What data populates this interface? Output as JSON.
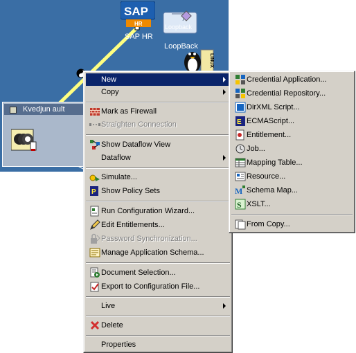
{
  "canvas": {
    "nodes": {
      "sap": {
        "logo_text": "SAP",
        "badge": "HR",
        "label": "SAP HR"
      },
      "loopback": {
        "logo_text": "Loopback",
        "label": "LoopBack"
      },
      "linux": {
        "logo_text": "LINUX"
      }
    },
    "vault": {
      "title": "Kvedjun ault"
    },
    "colors": {
      "background": "#3a6ea5",
      "link": "#ffff80"
    }
  },
  "context_menu": {
    "items": {
      "new": {
        "label": "New",
        "icon": "none",
        "highlighted": true,
        "submenu": true
      },
      "copy": {
        "label": "Copy",
        "submenu": true
      },
      "mark_firewall": {
        "label": "Mark as Firewall",
        "icon": "firewall-icon"
      },
      "straighten": {
        "label": "Straighten Connection",
        "icon": "connection-icon",
        "disabled": true
      },
      "dataflow_view": {
        "label": "Show Dataflow View",
        "icon": "dataflow-icon"
      },
      "dataflow": {
        "label": "Dataflow",
        "submenu": true
      },
      "simulate": {
        "label": "Simulate...",
        "icon": "simulate-icon"
      },
      "policy_sets": {
        "label": "Show Policy Sets",
        "icon": "policy-icon"
      },
      "config_wizard": {
        "label": "Run Configuration Wizard...",
        "icon": "wizard-icon"
      },
      "edit_entitlements": {
        "label": "Edit Entitlements...",
        "icon": "pencil-icon"
      },
      "password_sync": {
        "label": "Password Synchronization...",
        "icon": "password-icon",
        "disabled": true
      },
      "manage_schema": {
        "label": "Manage Application Schema...",
        "icon": "schema-icon"
      },
      "document_selection": {
        "label": "Document Selection...",
        "icon": "document-icon"
      },
      "export_config": {
        "label": "Export to Configuration File...",
        "icon": "export-icon"
      },
      "live": {
        "label": "Live",
        "submenu": true
      },
      "delete": {
        "label": "Delete",
        "icon": "delete-x-icon"
      },
      "properties": {
        "label": "Properties"
      }
    }
  },
  "new_submenu": {
    "items": {
      "credential_application": {
        "label": "Credential Application...",
        "icon": "credential-app-icon"
      },
      "credential_repository": {
        "label": "Credential Repository...",
        "icon": "credential-repo-icon"
      },
      "dirxml_script": {
        "label": "DirXML Script...",
        "icon": "dirxml-script-icon"
      },
      "ecmascript": {
        "label": "ECMAScript...",
        "icon": "ecmascript-icon"
      },
      "entitlement": {
        "label": "Entitlement...",
        "icon": "entitlement-icon"
      },
      "job": {
        "label": "Job...",
        "icon": "job-icon"
      },
      "mapping_table": {
        "label": "Mapping Table...",
        "icon": "mapping-table-icon"
      },
      "resource": {
        "label": "Resource...",
        "icon": "resource-icon"
      },
      "schema_map": {
        "label": "Schema Map...",
        "icon": "schema-map-icon"
      },
      "xslt": {
        "label": "XSLT...",
        "icon": "xslt-icon"
      },
      "from_copy": {
        "label": "From Copy...",
        "icon": "from-copy-icon"
      }
    }
  },
  "theme": {
    "menu_bg": "#d4d0c8",
    "highlight": "#0a246a",
    "disabled_text": "#808080"
  }
}
